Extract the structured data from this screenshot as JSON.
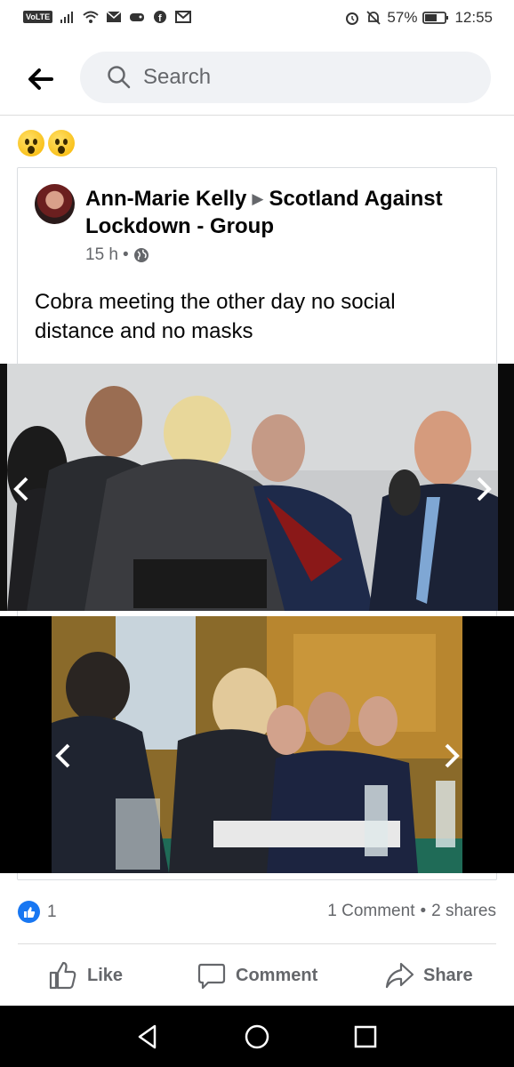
{
  "status_bar": {
    "volte": "VoLTE",
    "battery": "57%",
    "time": "12:55"
  },
  "header": {
    "search_placeholder": "Search"
  },
  "post": {
    "reaction_text_icons": [
      "astonished-face-emoji",
      "astonished-face-emoji"
    ],
    "author": "Ann-Marie Kelly",
    "group": "Scotland Against Lockdown - Group",
    "time": "15 h",
    "privacy_icon": "globe-icon",
    "text": "Cobra meeting the other day no social distance and no masks"
  },
  "engagement": {
    "likes": "1",
    "comments": "1 Comment",
    "separator": "•",
    "shares": "2 shares"
  },
  "actions": {
    "like": "Like",
    "comment": "Comment",
    "share": "Share"
  },
  "colors": {
    "accent": "#1877f2",
    "secondary_text": "#65676b",
    "search_bg": "#f0f2f5"
  }
}
